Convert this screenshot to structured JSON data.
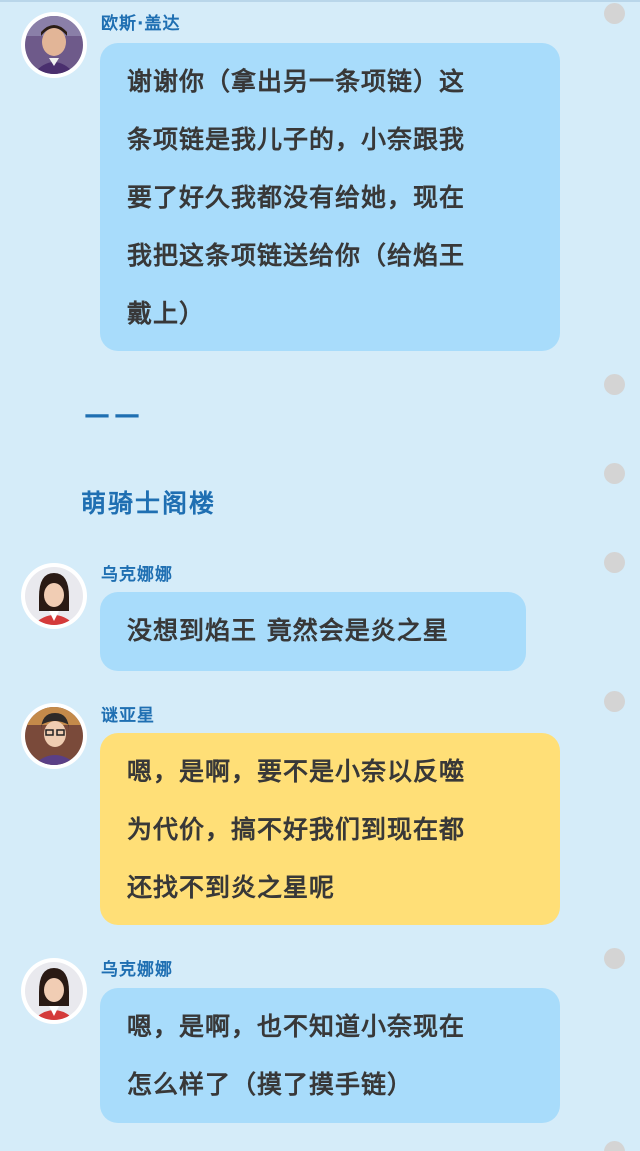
{
  "messages": [
    {
      "speaker": "欧斯·盖达",
      "color": "#a8dcfb",
      "avatar_icon": "man-avatar-icon",
      "lines": [
        "谢谢你（拿出另一条项链）这",
        "条项链是我儿子的，小奈跟我",
        "要了好久我都没有给她，现在",
        "我把这条项链送给你（给焰王",
        "戴上）"
      ]
    },
    {
      "speaker": "乌克娜娜",
      "color": "#a8dcfb",
      "avatar_icon": "woman-avatar-icon",
      "lines": [
        "没想到焰王 竟然会是炎之星"
      ]
    },
    {
      "speaker": "谜亚星",
      "color": "#ffdf77",
      "avatar_icon": "glasses-man-avatar-icon",
      "lines": [
        "嗯，是啊，要不是小奈以反噬",
        "为代价，搞不好我们到现在都",
        "还找不到炎之星呢"
      ]
    },
    {
      "speaker": "乌克娜娜",
      "color": "#a8dcfb",
      "avatar_icon": "woman-avatar-icon",
      "lines": [
        "嗯，是啊，也不知道小奈现在",
        "怎么样了（摸了摸手链）"
      ]
    }
  ],
  "divider_text": "——",
  "section_heading": "萌骑士阁楼"
}
